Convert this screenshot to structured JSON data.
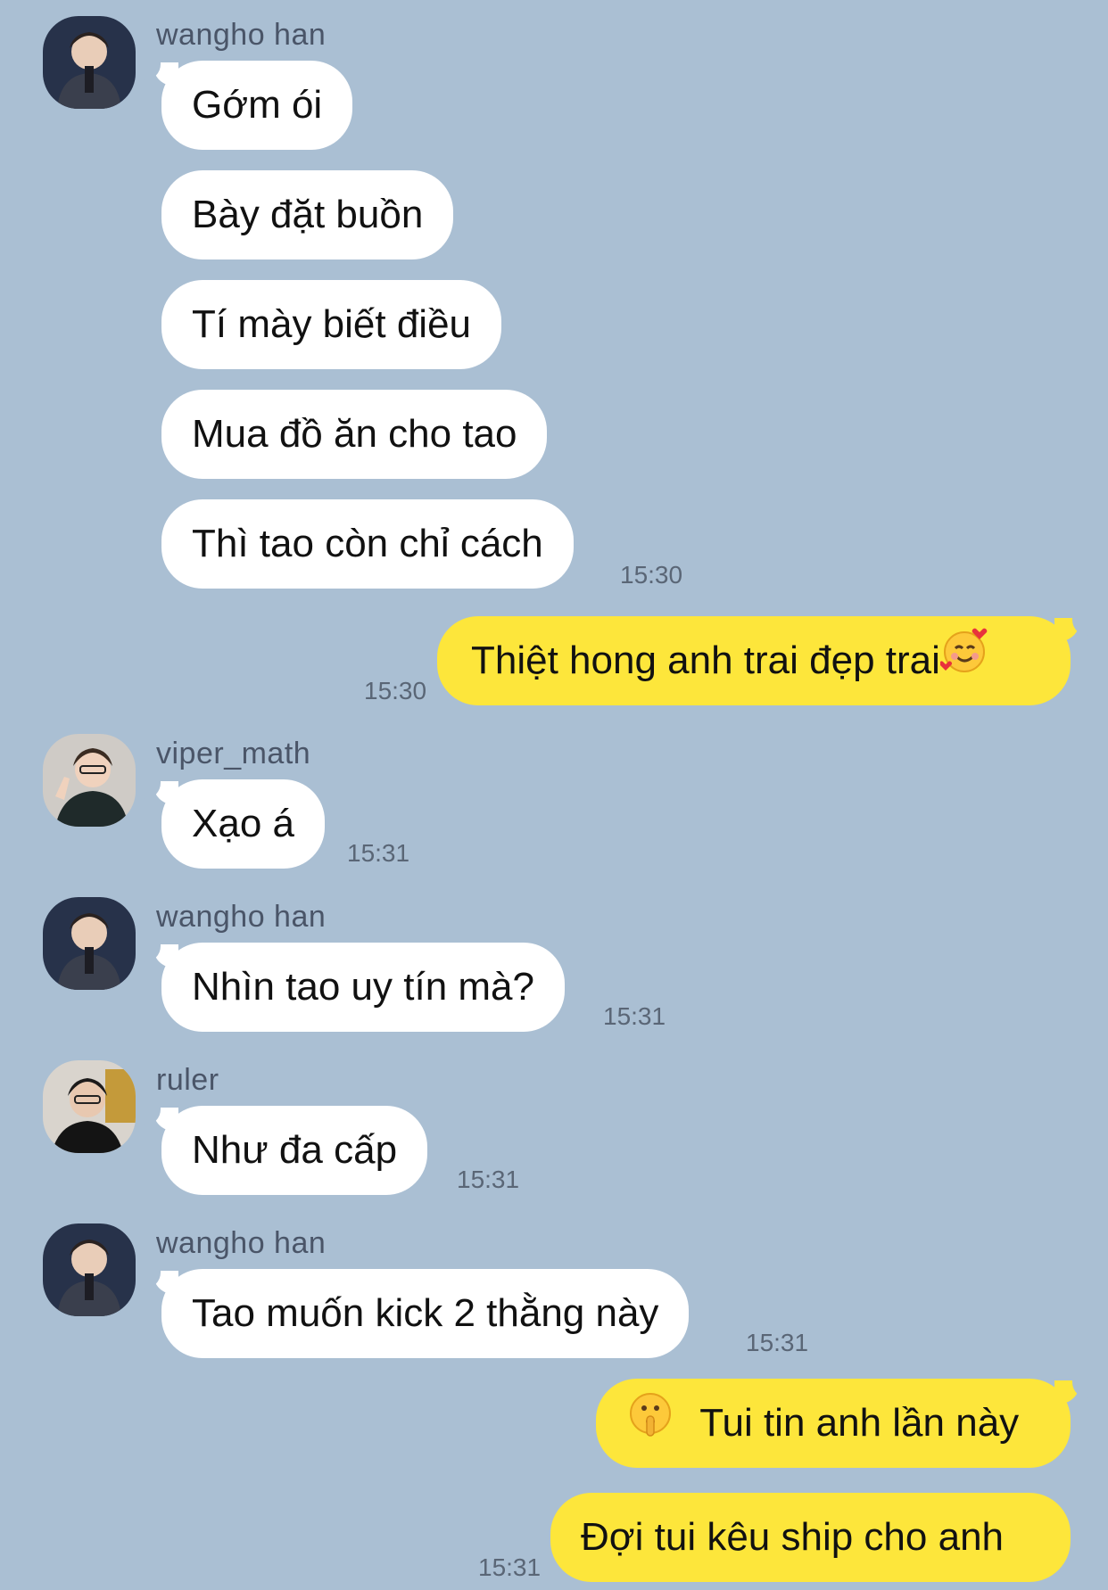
{
  "messages": [
    {
      "sender": "wangho han",
      "avatar_icon": "wangho-avatar-icon",
      "lines": [
        "Gớm ói",
        "Bày đặt buồn",
        "Tí mày biết điều",
        "Mua đồ ăn cho tao",
        "Thì tao còn chỉ cách"
      ],
      "time": "15:30"
    },
    {
      "outgoing": true,
      "text": "Thiệt hong anh trai đẹp trai",
      "emoji": "smiling-face-with-hearts-icon",
      "time": "15:30"
    },
    {
      "sender": "viper_math",
      "avatar_icon": "viper-avatar-icon",
      "text": "Xạo á",
      "time": "15:31"
    },
    {
      "sender": "wangho han",
      "avatar_icon": "wangho-avatar-icon",
      "text": "Nhìn tao uy tín mà?",
      "time": "15:31"
    },
    {
      "sender": "ruler",
      "avatar_icon": "ruler-avatar-icon",
      "text": "Như đa cấp",
      "time": "15:31"
    },
    {
      "sender": "wangho han",
      "avatar_icon": "wangho-avatar-icon",
      "text": "Tao muốn kick 2 thằng này",
      "time": "15:31"
    },
    {
      "outgoing": true,
      "emoji": "shushing-face-icon",
      "lines": [
        "Tui tin anh lần này",
        "Đợi tui kêu ship cho anh"
      ],
      "time": "15:31"
    }
  ],
  "colors": {
    "background": "#aabfd3",
    "incoming_bubble": "#ffffff",
    "outgoing_bubble": "#fde63b"
  }
}
